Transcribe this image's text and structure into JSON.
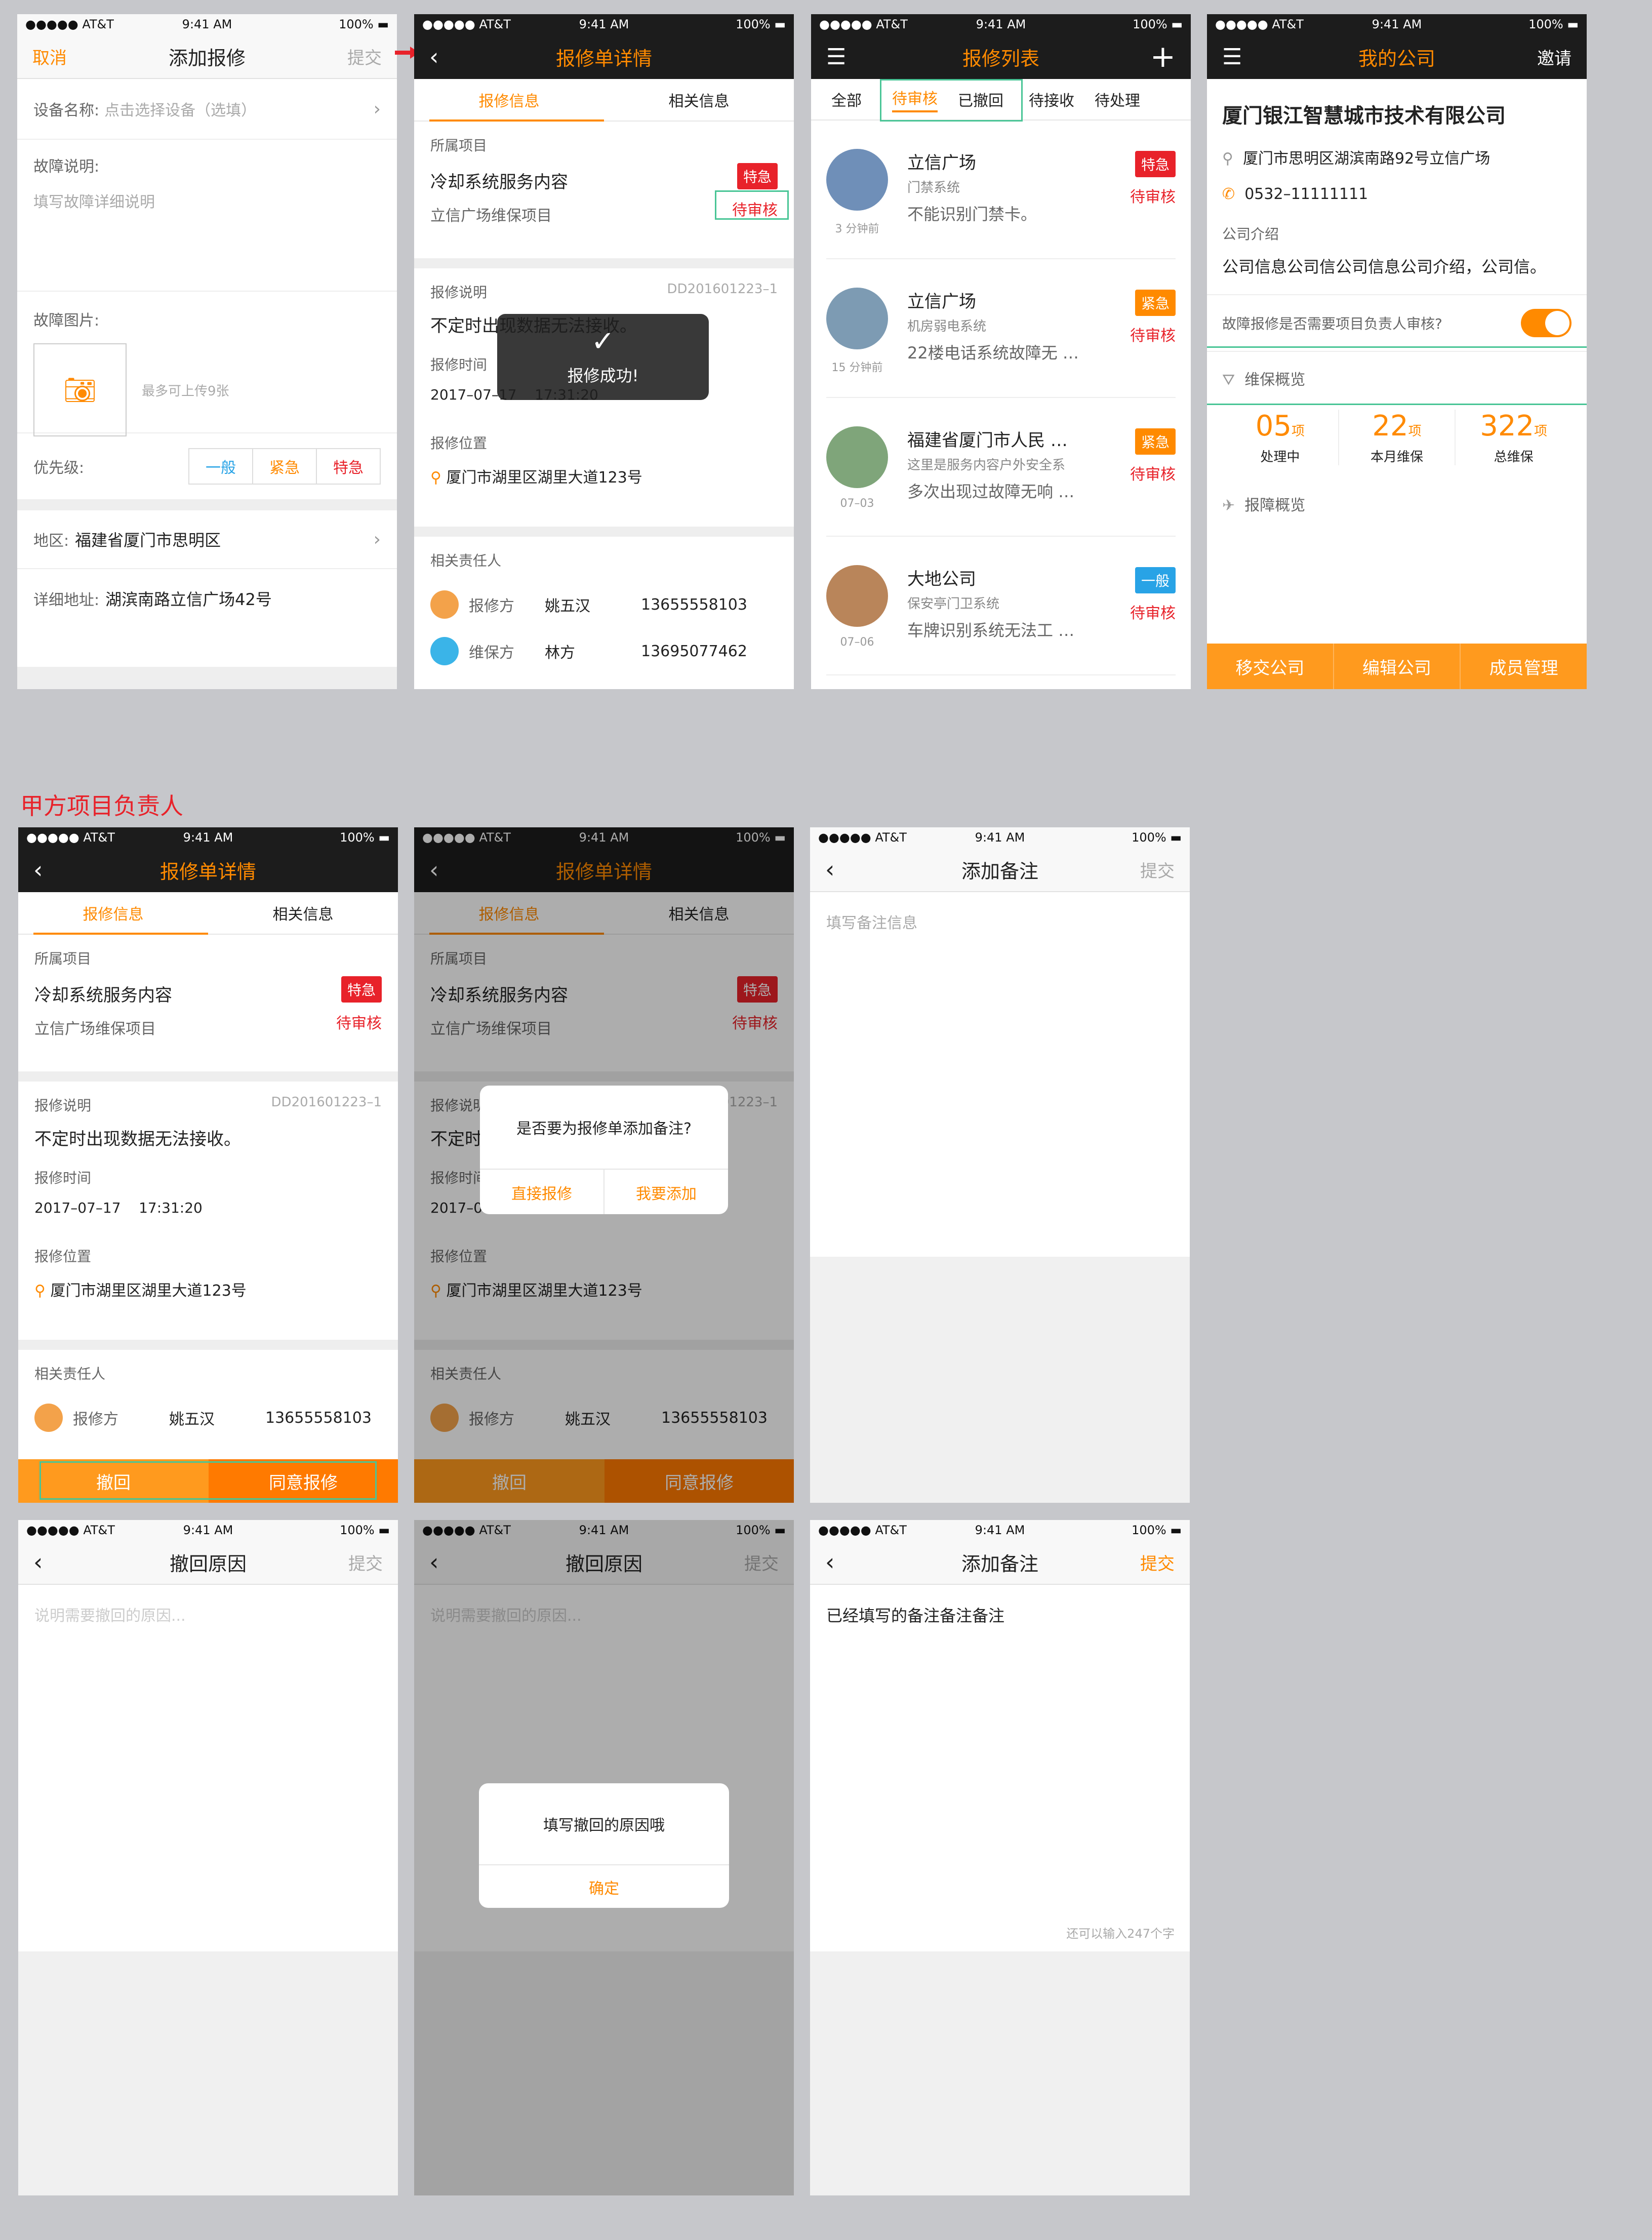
{
  "status": {
    "carrier": "●●●●● AT&T",
    "time": "9:41 AM",
    "battery": "100%"
  },
  "section_label": "甲方项目负责人",
  "s1": {
    "cancel": "取消",
    "title": "添加报修",
    "submit": "提交",
    "device_label": "设备名称:",
    "device_placeholder": "点击选择设备（选填）",
    "fault_label": "故障说明:",
    "fault_placeholder": "填写故障详细说明",
    "image_label": "故障图片:",
    "image_hint": "最多可上传9张",
    "priority_label": "优先级:",
    "priority": [
      "一般",
      "紧急",
      "特急"
    ],
    "region_label": "地区:",
    "region_value": "福建省厦门市思明区",
    "address_label": "详细地址:",
    "address_value": "湖滨南路立信广场42号"
  },
  "detail": {
    "title": "报修单详情",
    "tab_info": "报修信息",
    "tab_related": "相关信息",
    "project_label": "所属项目",
    "project_name": "冷却系统服务内容",
    "project_sub": "立信广场维保项目",
    "badge": "特急",
    "state": "待审核",
    "desc_label": "报修说明",
    "order_no": "DD201601223–1",
    "desc": "不定时出现数据无法接收。",
    "time_label": "报修时间",
    "time_value": "2017–07–17    17:31:20",
    "loc_label": "报修位置",
    "loc_value": "厦门市湖里区湖里大道123号",
    "people_label": "相关责任人",
    "reporter_role": "报修方",
    "reporter_name": "姚五汉",
    "reporter_phone": "13655558103",
    "maint_role": "维保方",
    "maint_name": "林方",
    "maint_phone": "13695077462",
    "toast": "报修成功!",
    "btn_withdraw": "撤回",
    "btn_agree": "同意报修",
    "dialog_q": "是否要为报修单添加备注?",
    "dialog_direct": "直接报修",
    "dialog_add": "我要添加"
  },
  "list": {
    "title": "报修列表",
    "tabs": [
      "全部",
      "待审核",
      "已撤回",
      "待接收",
      "待处理"
    ],
    "items": [
      {
        "name": "立信广场",
        "system": "门禁系统",
        "desc": "不能识别门禁卡。",
        "time": "3 分钟前",
        "badge": "特急",
        "state": "待审核"
      },
      {
        "name": "立信广场",
        "system": "机房弱电系统",
        "desc": "22楼电话系统故障无 …",
        "time": "15 分钟前",
        "badge": "紧急",
        "state": "待审核"
      },
      {
        "name": "福建省厦门市人民 …",
        "system": "这里是服务内容户外安全系",
        "desc": "多次出现过故障无响 …",
        "time": "07–03",
        "badge": "紧急",
        "state": "待审核"
      },
      {
        "name": "大地公司",
        "system": "保安亭门卫系统",
        "desc": "车牌识别系统无法工 …",
        "time": "07–06",
        "badge": "一般",
        "state": "待审核"
      }
    ]
  },
  "company": {
    "title": "我的公司",
    "invite": "邀请",
    "name": "厦门银江智慧城市技术有限公司",
    "address": "厦门市思明区湖滨南路92号立信广场",
    "phone": "0532–11111111",
    "intro_label": "公司介绍",
    "intro": "公司信息公司信公司信息公司介绍，公司信。",
    "toggle_label": "故障报修是否需要项目负责人审核?",
    "overview_label": "维保概览",
    "stats": [
      {
        "num": "05",
        "unit": "项",
        "label": "处理中"
      },
      {
        "num": "22",
        "unit": "项",
        "label": "本月维保"
      },
      {
        "num": "322",
        "unit": "项",
        "label": "总维保"
      }
    ],
    "fault_overview_label": "报障概览",
    "btns": [
      "移交公司",
      "编辑公司",
      "成员管理"
    ]
  },
  "note": {
    "title": "添加备注",
    "submit": "提交",
    "placeholder": "填写备注信息",
    "filled": "已经填写的备注备注备注",
    "counter": "还可以输入247个字"
  },
  "withdraw": {
    "title": "撤回原因",
    "submit": "提交",
    "placeholder": "说明需要撤回的原因...",
    "alert": "填写撤回的原因哦",
    "ok": "确定"
  }
}
